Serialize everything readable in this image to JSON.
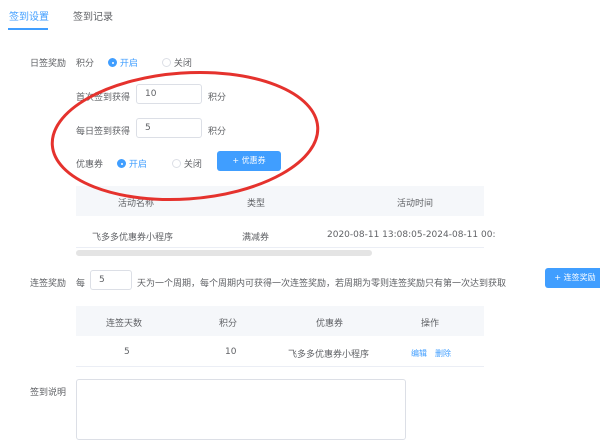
{
  "tabs": [
    {
      "label": "签到设置"
    },
    {
      "label": "签到记录"
    }
  ],
  "daily": {
    "label": "日签奖励",
    "points_label": "积分",
    "on": "开启",
    "off": "关闭",
    "first_label": "首次签到获得",
    "first_value": "10",
    "daily_label": "每日签到获得",
    "daily_value": "5",
    "unit": "积分",
    "coupon_label": "优惠券",
    "coupon_btn": "+ 优惠券"
  },
  "coupon_table": {
    "headers": [
      "活动名称",
      "类型",
      "活动时间"
    ],
    "rows": [
      [
        "飞多多优惠券小程序",
        "满减券",
        "2020-08-11 13:08:05-2024-08-11 00:"
      ]
    ]
  },
  "streak": {
    "label": "连签奖励",
    "every": "每",
    "days_value": "5",
    "desc": "天为一个周期，每个周期内可获得一次连签奖励，若周期为零则连签奖励只有第一次达到获取",
    "add_btn": "+ 连签奖励"
  },
  "streak_table": {
    "headers": [
      "连签天数",
      "积分",
      "优惠券",
      "操作"
    ],
    "rows": [
      {
        "days": "5",
        "points": "10",
        "coupon": "飞多多优惠券小程序",
        "edit": "编辑",
        "delete": "删除"
      }
    ]
  },
  "desc_label": "签到说明",
  "colors": {
    "accent": "#409eff",
    "annotation": "#e5322d"
  }
}
